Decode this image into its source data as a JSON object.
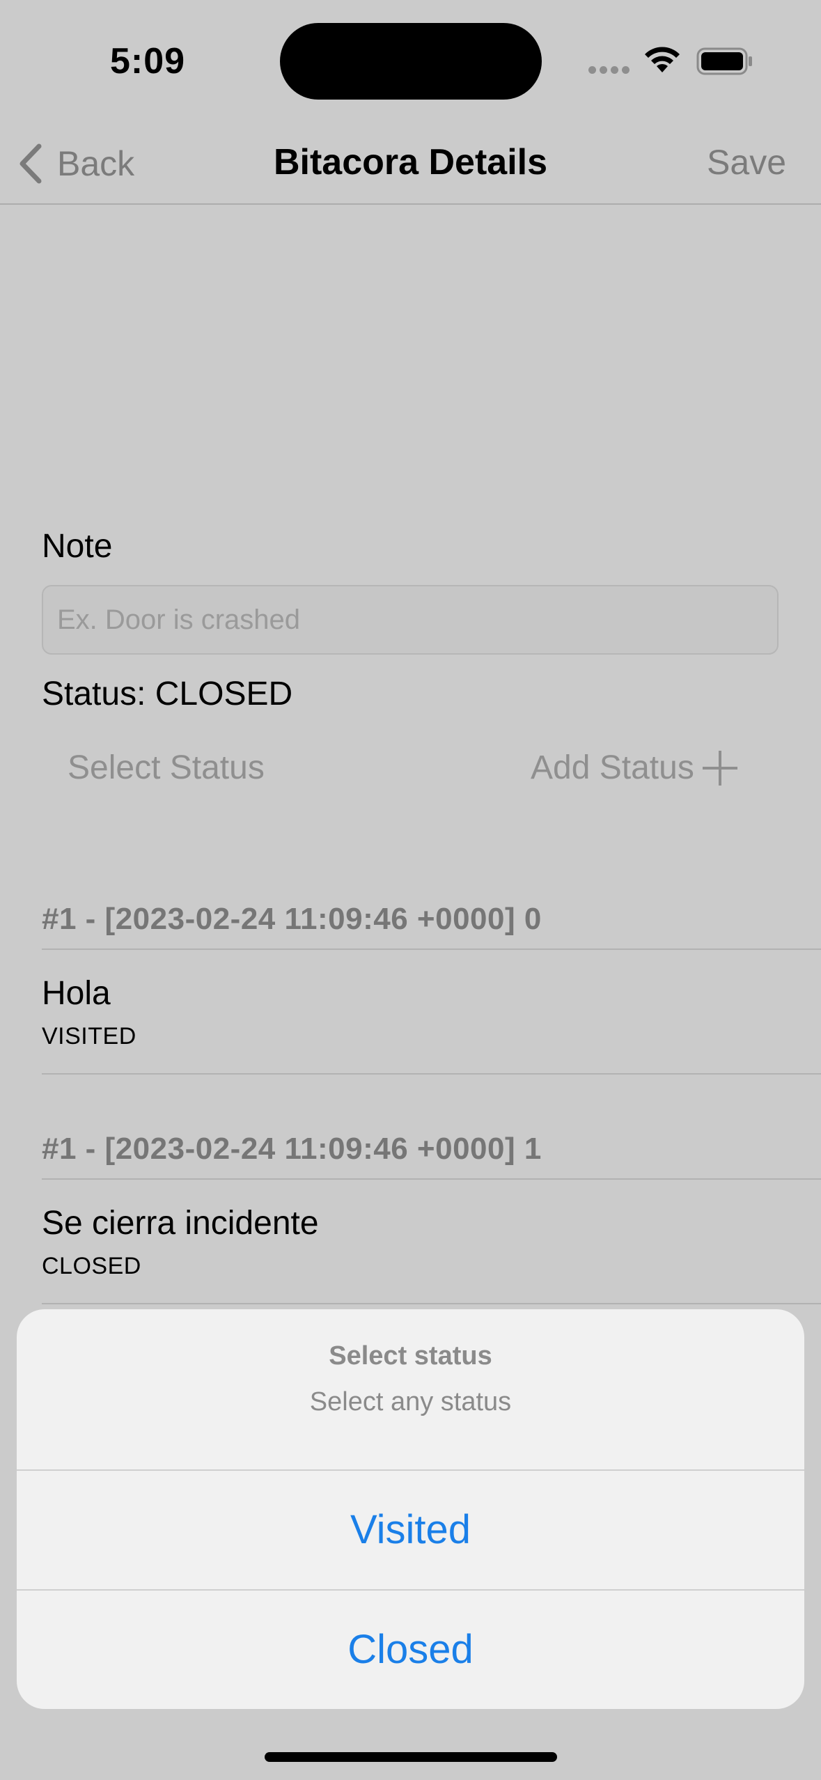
{
  "status_bar": {
    "time": "5:09"
  },
  "nav": {
    "back_label": "Back",
    "title": "Bitacora Details",
    "save_label": "Save"
  },
  "form": {
    "note_label": "Note",
    "note_placeholder": "Ex. Door is crashed",
    "note_value": "",
    "status_text": "Status: CLOSED",
    "select_status_label": "Select Status",
    "add_status_label": "Add Status"
  },
  "log_entries": [
    {
      "header": "#1 - [2023-02-24 11:09:46 +0000] 0",
      "note": "Hola",
      "status": "VISITED"
    },
    {
      "header": "#1 - [2023-02-24 11:09:46 +0000] 1",
      "note": "Se cierra incidente",
      "status": "CLOSED"
    }
  ],
  "action_sheet": {
    "title": "Select status",
    "message": "Select any status",
    "options": [
      "Visited",
      "Closed"
    ]
  },
  "colors": {
    "background": "#cbcbcb",
    "accent": "#1a7fe8",
    "disabled_text": "#8f8f8f"
  }
}
